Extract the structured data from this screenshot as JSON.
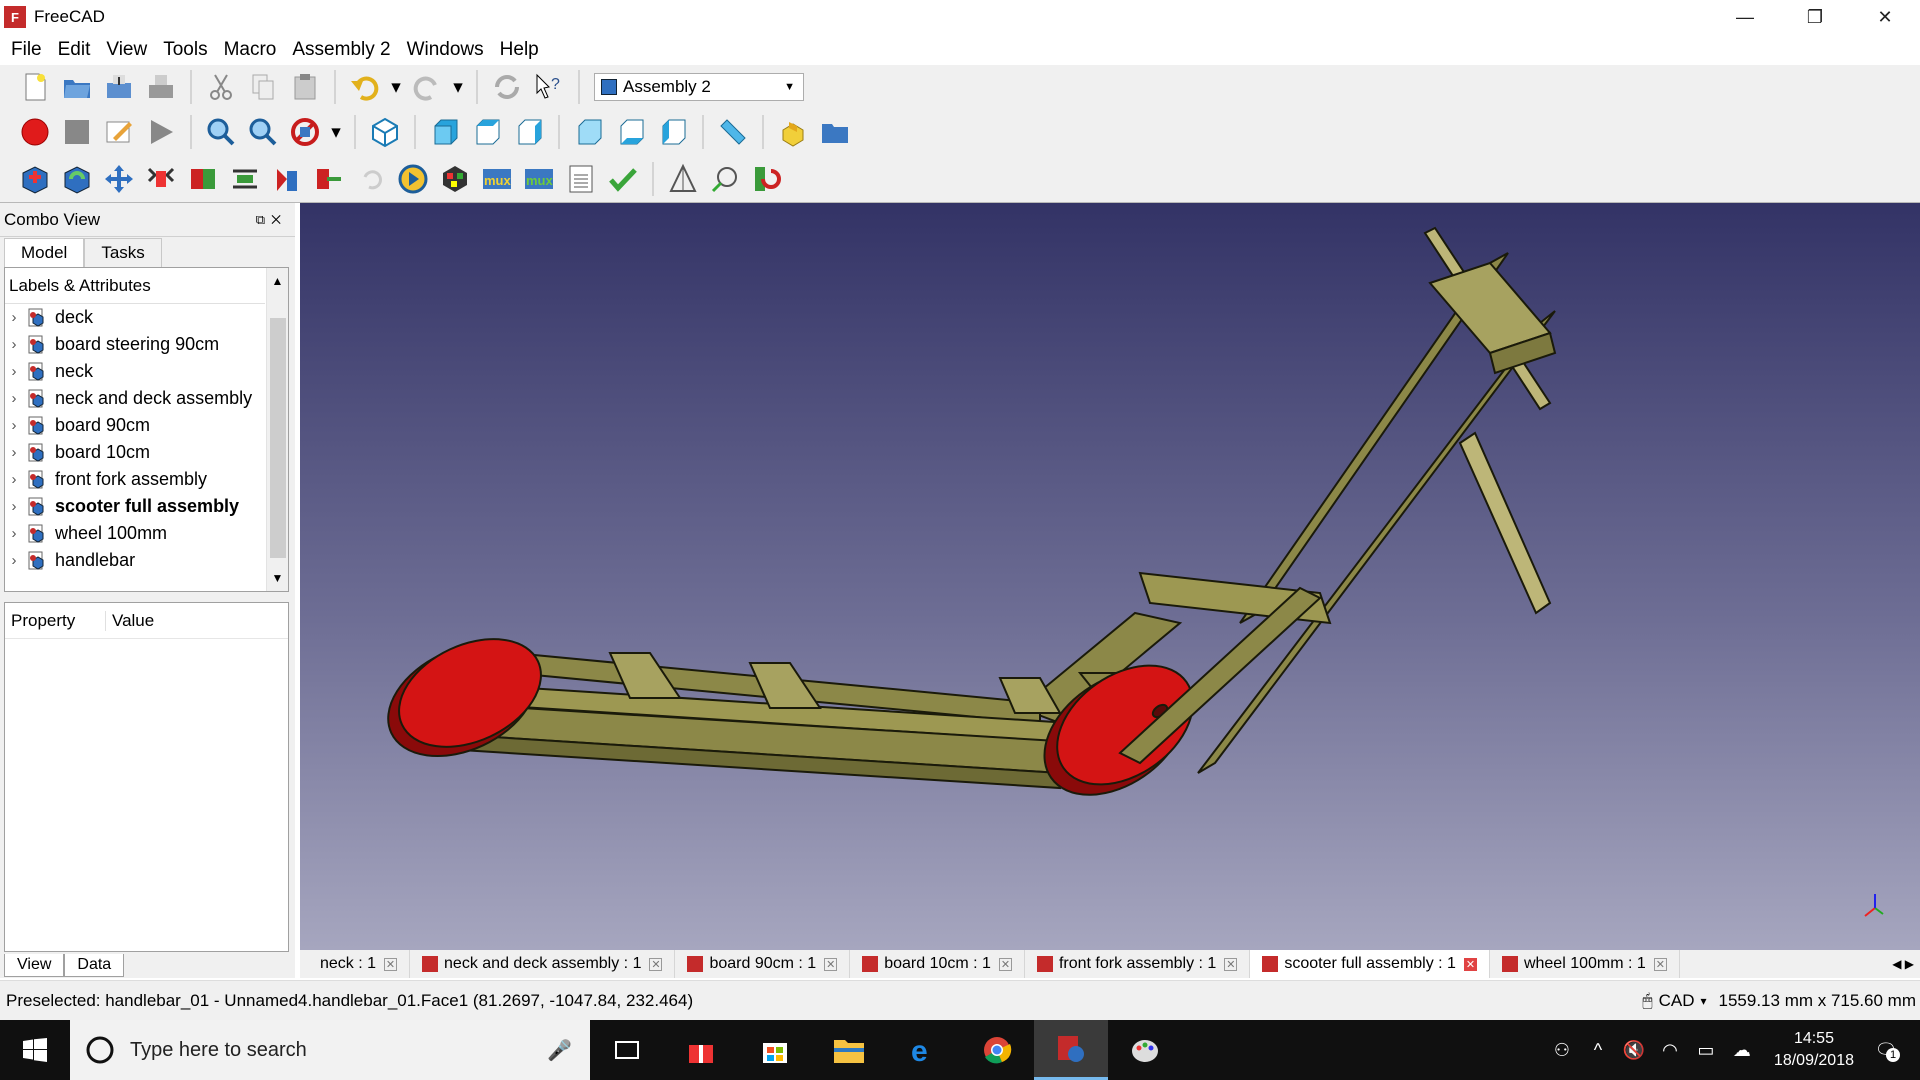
{
  "window": {
    "title": "FreeCAD",
    "controls": {
      "minimize": "—",
      "restore": "❐",
      "close": "✕"
    }
  },
  "menu": [
    "File",
    "Edit",
    "View",
    "Tools",
    "Macro",
    "Assembly 2",
    "Windows",
    "Help"
  ],
  "workbench": {
    "selected": "Assembly 2"
  },
  "combo_view": {
    "title": "Combo View",
    "tabs": [
      "Model",
      "Tasks"
    ],
    "tree_header": "Labels & Attributes",
    "tree_items": [
      {
        "label": "deck",
        "bold": false
      },
      {
        "label": "board steering 90cm",
        "bold": false
      },
      {
        "label": "neck",
        "bold": false
      },
      {
        "label": "neck and deck assembly",
        "bold": false
      },
      {
        "label": "board 90cm",
        "bold": false
      },
      {
        "label": "board 10cm",
        "bold": false
      },
      {
        "label": "front fork assembly",
        "bold": false
      },
      {
        "label": "scooter full assembly",
        "bold": true
      },
      {
        "label": "wheel 100mm",
        "bold": false
      },
      {
        "label": "handlebar",
        "bold": false
      }
    ],
    "property_header": "Property",
    "value_header": "Value",
    "view_tabs": [
      "View",
      "Data"
    ]
  },
  "doc_tabs": [
    {
      "label": "neck : 1",
      "active": false
    },
    {
      "label": "neck and deck assembly : 1",
      "active": false
    },
    {
      "label": "board 90cm : 1",
      "active": false
    },
    {
      "label": "board 10cm : 1",
      "active": false
    },
    {
      "label": "front fork assembly : 1",
      "active": false
    },
    {
      "label": "scooter full assembly : 1",
      "active": true
    },
    {
      "label": "wheel 100mm : 1",
      "active": false
    }
  ],
  "status": {
    "preselected": "Preselected: handlebar_01 - Unnamed4.handlebar_01.Face1 (81.2697, -1047.84, 232.464)",
    "nav_style": "CAD",
    "dimensions": "1559.13 mm x 715.60 mm"
  },
  "taskbar": {
    "search_placeholder": "Type here to search",
    "time": "14:55",
    "date": "18/09/2018",
    "notifications": "1"
  },
  "colors": {
    "frame": "#8c8848",
    "wheel": "#d41414",
    "viewport_top": "#333366",
    "viewport_bottom": "#a6a6bf"
  }
}
